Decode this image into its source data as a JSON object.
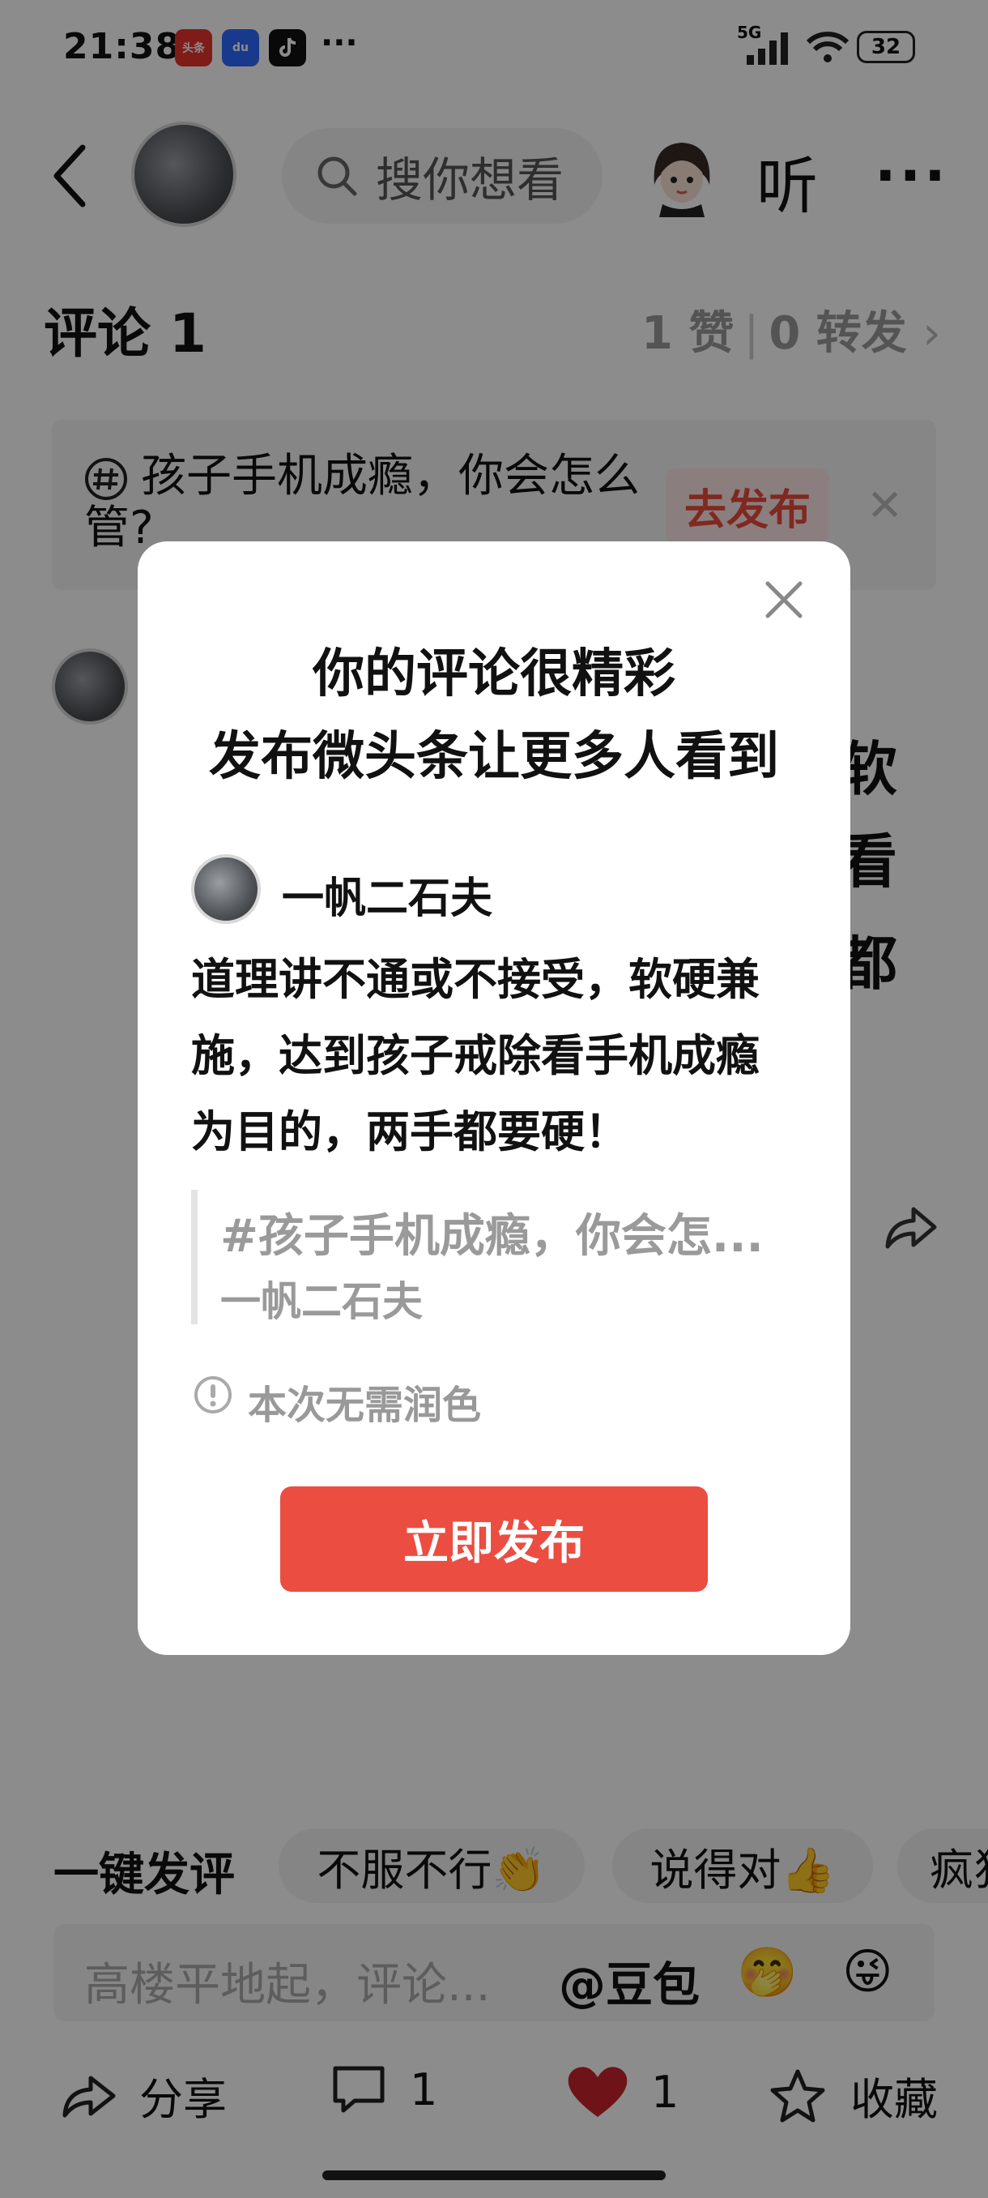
{
  "status_bar": {
    "time": "21:38",
    "app_icons": [
      "头条",
      "du"
    ],
    "more": "···",
    "network": "5G",
    "battery": "32"
  },
  "header": {
    "search_placeholder": "搜你想看",
    "listen": "听",
    "more": "···"
  },
  "comments": {
    "title": "评论 1",
    "likes": "1 赞",
    "reposts": "0 转发"
  },
  "topic": {
    "text": "孩子手机成瘾，你会怎么管?",
    "button": "去发布"
  },
  "background_comment_fragments": [
    "软",
    "看",
    "都"
  ],
  "quick_reply": {
    "label": "一键发评",
    "chips": [
      "不服不行👏",
      "说得对👍",
      "疯狂"
    ]
  },
  "input": {
    "placeholder": "高楼平地起，评论...",
    "at": "@豆包",
    "emojis": [
      "🤭",
      "😜"
    ]
  },
  "bottom_bar": {
    "share": "分享",
    "comment_count": "1",
    "like_count": "1",
    "favorite": "收藏"
  },
  "modal": {
    "title_line1": "你的评论很精彩",
    "title_line2": "发布微头条让更多人看到",
    "author": "一帆二石夫",
    "body": "道理讲不通或不接受，软硬兼施，达到孩子戒除看手机成瘾为目的，两手都要硬！",
    "quote_title": "#孩子手机成瘾，你会怎...",
    "quote_author": "一帆二石夫",
    "info": "本次无需润色",
    "publish_button": "立即发布"
  },
  "colors": {
    "accent_red": "#eb4d41",
    "heart_red": "#c8232c",
    "overlay": "rgba(0,0,0,0.45)"
  }
}
